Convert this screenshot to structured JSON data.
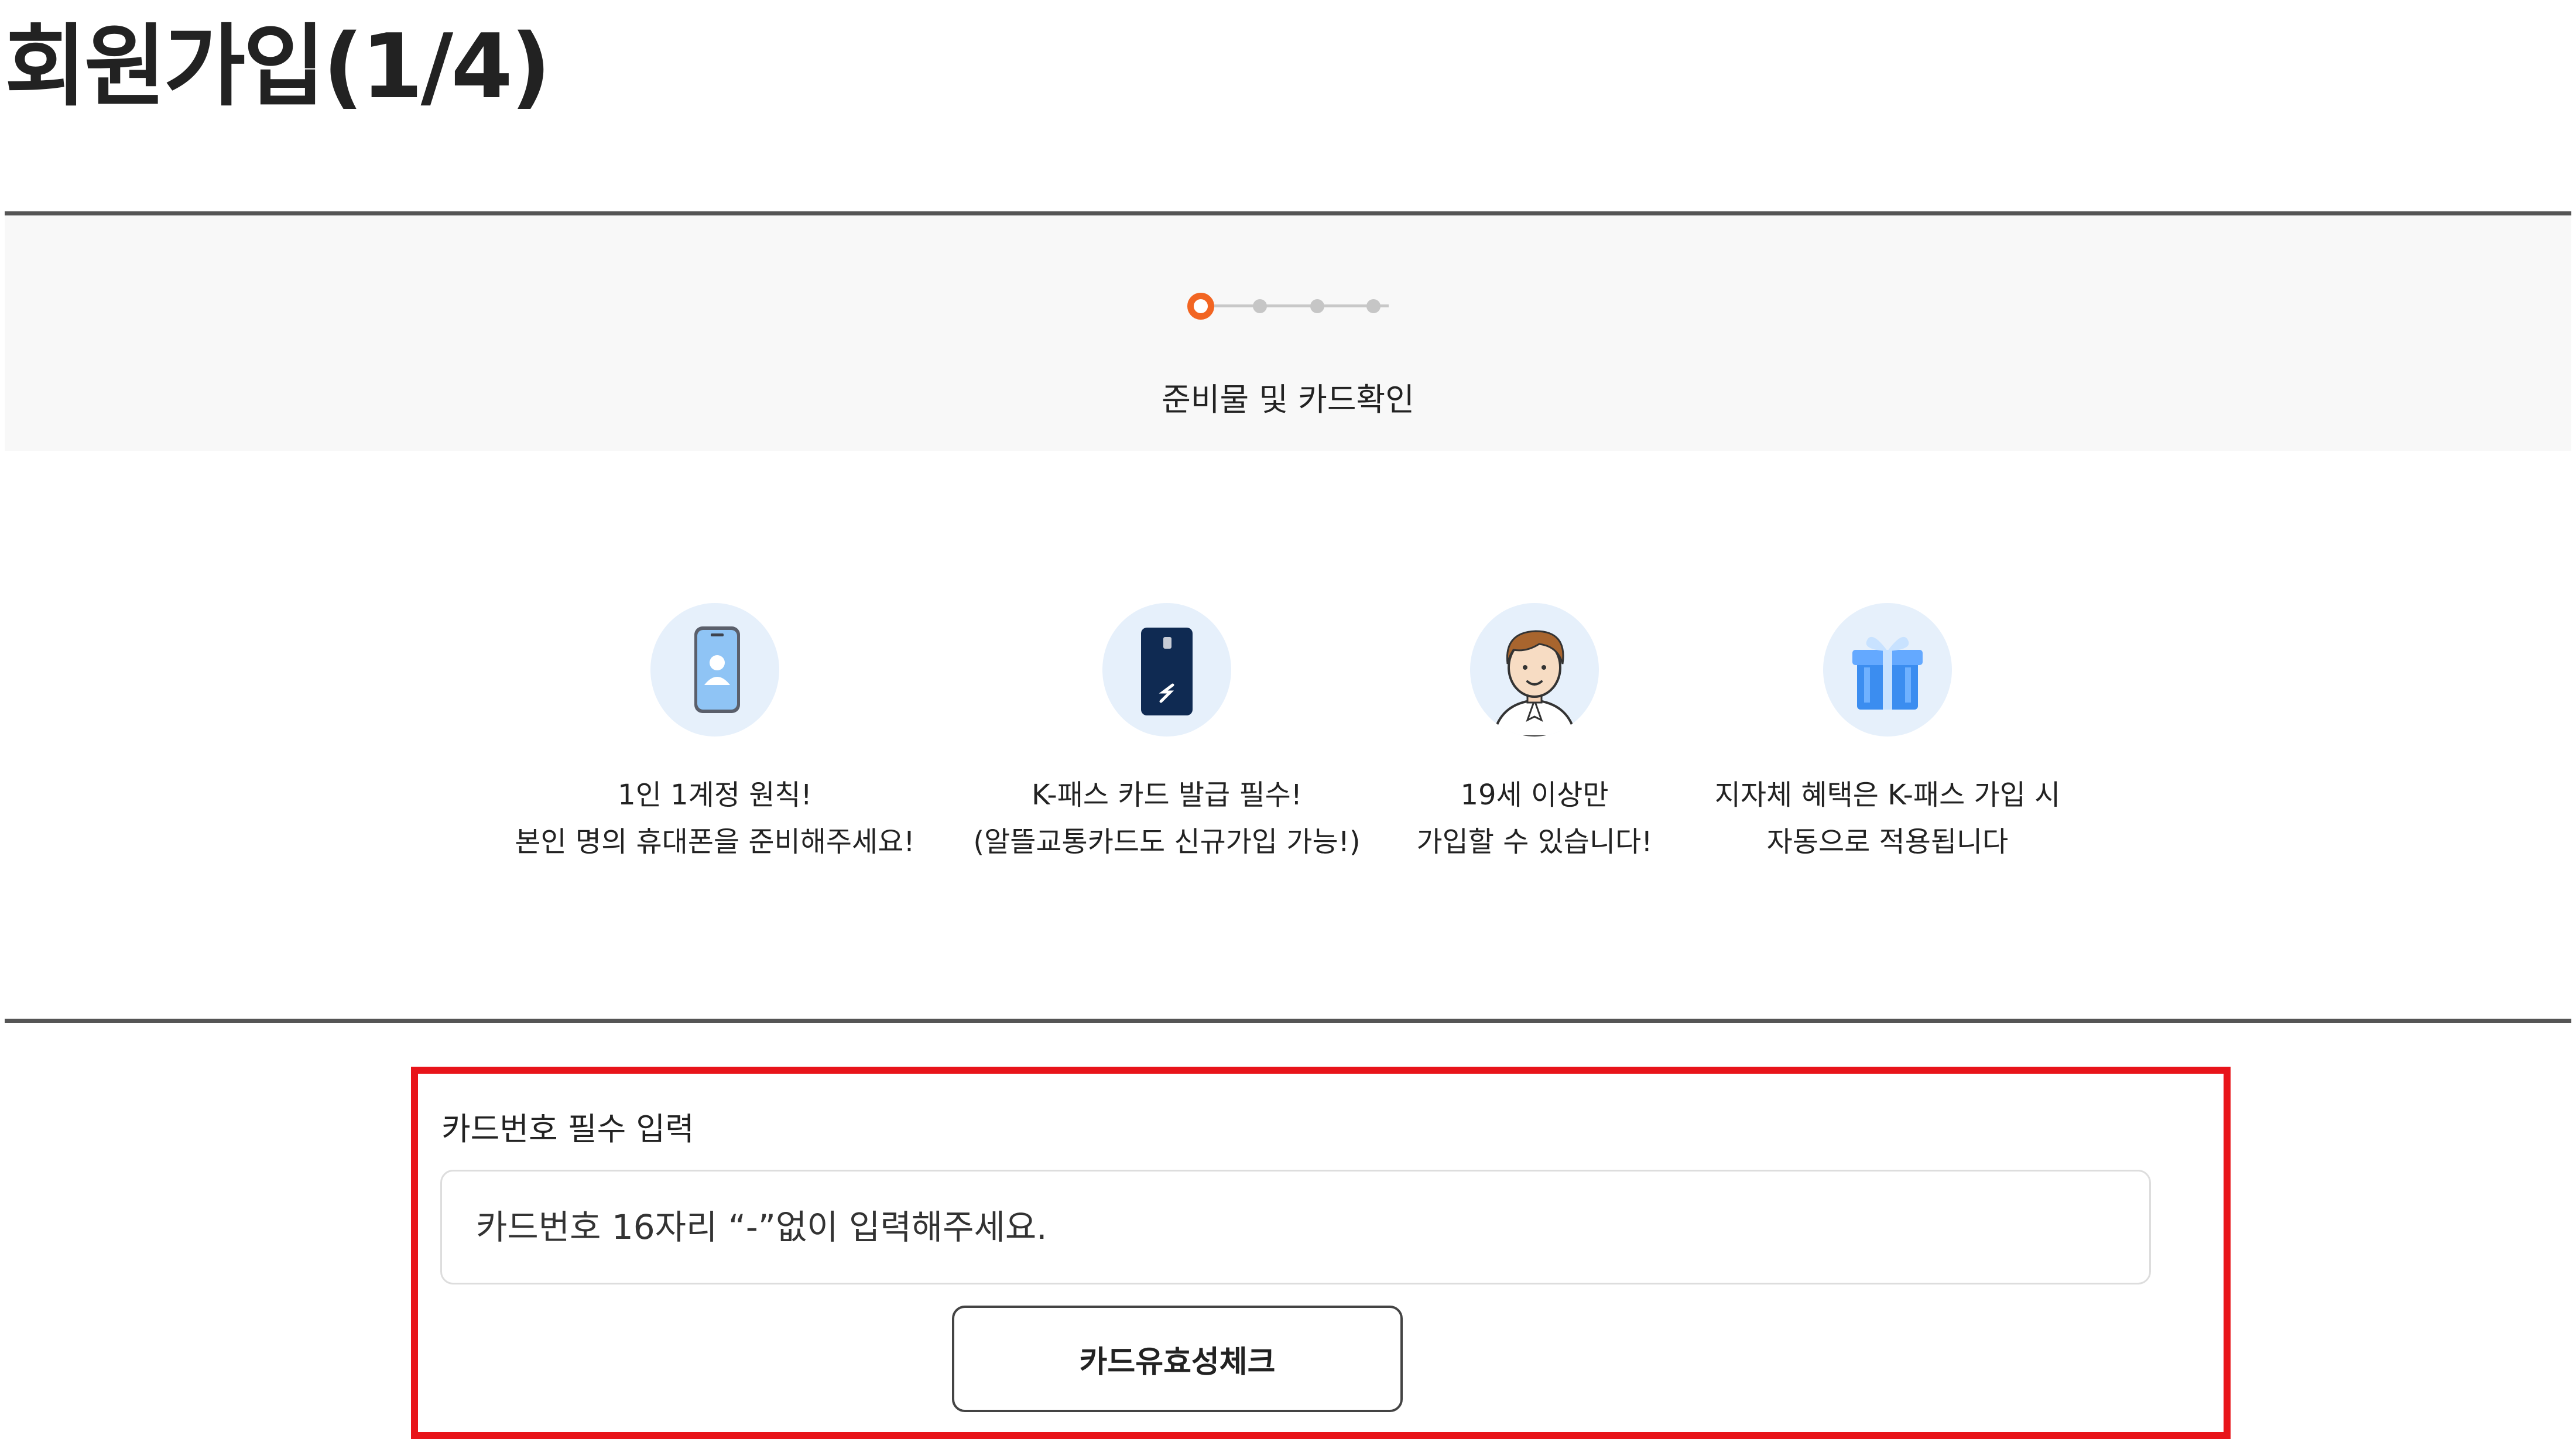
{
  "page": {
    "title": "회원가입(1/4)"
  },
  "stepper": {
    "total_steps": 4,
    "current_step": 1,
    "current_label": "준비물 및 카드확인",
    "active_color": "#f26522",
    "inactive_color": "#c6c6c6"
  },
  "features": [
    {
      "icon": "smartphone-user-icon",
      "line1": "1인 1계정 원칙!",
      "line2": "본인 명의 휴대폰을 준비해주세요!"
    },
    {
      "icon": "k-pass-card-icon",
      "line1": "K-패스 카드 발급 필수!",
      "line2": "(알뜰교통카드도 신규가입 가능!)"
    },
    {
      "icon": "adult-person-icon",
      "line1": "19세 이상만",
      "line2": "가입할 수 있습니다!"
    },
    {
      "icon": "gift-box-icon",
      "line1": "지자체 혜택은 K-패스 가입 시",
      "line2": "자동으로 적용됩니다"
    }
  ],
  "card_form": {
    "label": "카드번호 필수 입력",
    "input_placeholder": "카드번호 16자리 “-”없이 입력해주세요.",
    "input_value": "",
    "check_button_label": "카드유효성체크",
    "highlight_color": "#e8141a"
  }
}
